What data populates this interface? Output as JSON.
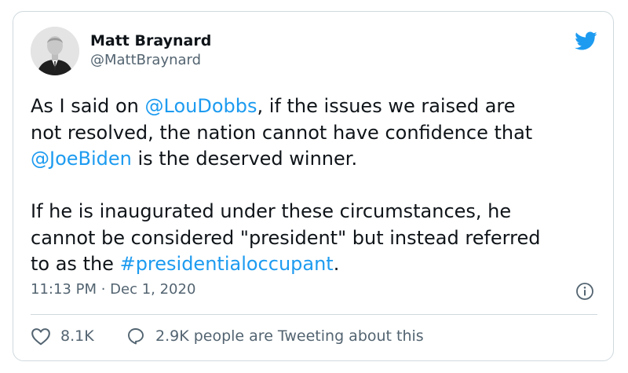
{
  "author": {
    "display_name": "Matt Braynard",
    "handle": "@MattBraynard"
  },
  "tweet": {
    "p1_a": "As I said on ",
    "p1_link1": "@LouDobbs",
    "p1_b": ", if the issues we raised are",
    "p1_c": "not resolved, the nation cannot have confidence that",
    "p1_link2": "@JoeBiden",
    "p1_d": " is the deserved winner.",
    "p2_a": "If he is inaugurated under these circumstances, he",
    "p2_b": "cannot be considered \"president\" but instead referred",
    "p2_c": "to as the ",
    "p2_link": "#presidentialoccupant",
    "p2_d": "."
  },
  "meta": {
    "timestamp": "11:13 PM · Dec 1, 2020"
  },
  "actions": {
    "like_count": "8.1K",
    "reply_text": "2.9K people are Tweeting about this"
  },
  "icons": {
    "brand": "twitter-bird-icon",
    "info": "info-icon",
    "like": "heart-icon",
    "reply": "speech-bubble-icon"
  },
  "colors": {
    "accent": "#1d9bf0",
    "text": "#0f1419",
    "muted": "#536471",
    "border": "#cfd9de"
  }
}
